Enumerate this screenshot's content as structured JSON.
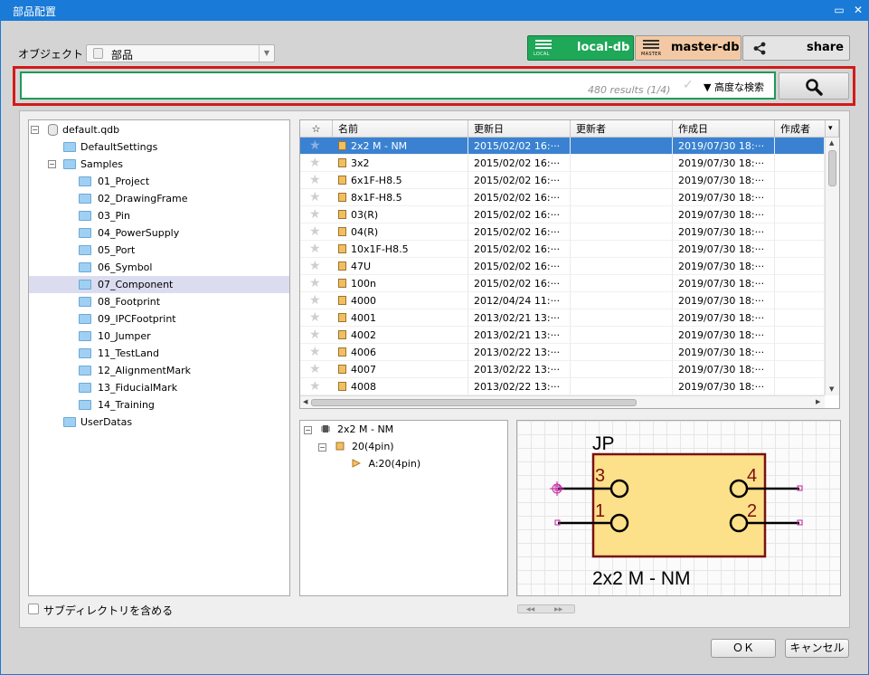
{
  "window": {
    "title": "部品配置",
    "minimize_glyph": "▭",
    "close_glyph": "✕"
  },
  "object": {
    "label": "オブジェクト",
    "value": "部品"
  },
  "db_buttons": [
    {
      "label": "local-db",
      "sub": "LOCAL",
      "color": "#1ea858"
    },
    {
      "label": "master-db",
      "sub": "MASTER",
      "color": "#f2c9a4"
    },
    {
      "label": "share"
    }
  ],
  "search": {
    "value": "",
    "results": "480 results (1/4)",
    "check": "✓",
    "advanced": "▼ 高度な検索"
  },
  "tree": [
    {
      "label": "default.qdb",
      "level": 0,
      "type": "db",
      "toggle": "−"
    },
    {
      "label": "DefaultSettings",
      "level": 1,
      "type": "folder"
    },
    {
      "label": "Samples",
      "level": 1,
      "type": "folder",
      "toggle": "−"
    },
    {
      "label": "01_Project",
      "level": 2,
      "type": "folder"
    },
    {
      "label": "02_DrawingFrame",
      "level": 2,
      "type": "folder"
    },
    {
      "label": "03_Pin",
      "level": 2,
      "type": "folder"
    },
    {
      "label": "04_PowerSupply",
      "level": 2,
      "type": "folder"
    },
    {
      "label": "05_Port",
      "level": 2,
      "type": "folder"
    },
    {
      "label": "06_Symbol",
      "level": 2,
      "type": "folder"
    },
    {
      "label": "07_Component",
      "level": 2,
      "type": "folder",
      "selected": true
    },
    {
      "label": "08_Footprint",
      "level": 2,
      "type": "folder"
    },
    {
      "label": "09_IPCFootprint",
      "level": 2,
      "type": "folder"
    },
    {
      "label": "10_Jumper",
      "level": 2,
      "type": "folder"
    },
    {
      "label": "11_TestLand",
      "level": 2,
      "type": "folder"
    },
    {
      "label": "12_AlignmentMark",
      "level": 2,
      "type": "folder"
    },
    {
      "label": "13_FiducialMark",
      "level": 2,
      "type": "folder"
    },
    {
      "label": "14_Training",
      "level": 2,
      "type": "folder"
    },
    {
      "label": "UserDatas",
      "level": 1,
      "type": "folder"
    }
  ],
  "grid": {
    "columns": [
      "☆",
      "名前",
      "更新日",
      "更新者",
      "作成日",
      "作成者"
    ],
    "menu_glyph": "▾",
    "rows": [
      {
        "star": "★",
        "name": "2x2 M - NM",
        "updated": "2015/02/02 16:···",
        "updater": "",
        "created": "2019/07/30 18:···",
        "creator": "",
        "selected": true
      },
      {
        "star": "★",
        "name": "3x2",
        "updated": "2015/02/02 16:···",
        "updater": "",
        "created": "2019/07/30 18:···",
        "creator": ""
      },
      {
        "star": "★",
        "name": "6x1F-H8.5",
        "updated": "2015/02/02 16:···",
        "updater": "",
        "created": "2019/07/30 18:···",
        "creator": ""
      },
      {
        "star": "★",
        "name": "8x1F-H8.5",
        "updated": "2015/02/02 16:···",
        "updater": "",
        "created": "2019/07/30 18:···",
        "creator": ""
      },
      {
        "star": "★",
        "name": "03(R)",
        "updated": "2015/02/02 16:···",
        "updater": "",
        "created": "2019/07/30 18:···",
        "creator": ""
      },
      {
        "star": "★",
        "name": "04(R)",
        "updated": "2015/02/02 16:···",
        "updater": "",
        "created": "2019/07/30 18:···",
        "creator": ""
      },
      {
        "star": "★",
        "name": "10x1F-H8.5",
        "updated": "2015/02/02 16:···",
        "updater": "",
        "created": "2019/07/30 18:···",
        "creator": ""
      },
      {
        "star": "★",
        "name": "47U",
        "updated": "2015/02/02 16:···",
        "updater": "",
        "created": "2019/07/30 18:···",
        "creator": ""
      },
      {
        "star": "★",
        "name": "100n",
        "updated": "2015/02/02 16:···",
        "updater": "",
        "created": "2019/07/30 18:···",
        "creator": ""
      },
      {
        "star": "★",
        "name": "4000",
        "updated": "2012/04/24 11:···",
        "updater": "",
        "created": "2019/07/30 18:···",
        "creator": ""
      },
      {
        "star": "★",
        "name": "4001",
        "updated": "2013/02/21 13:···",
        "updater": "",
        "created": "2019/07/30 18:···",
        "creator": ""
      },
      {
        "star": "★",
        "name": "4002",
        "updated": "2013/02/21 13:···",
        "updater": "",
        "created": "2019/07/30 18:···",
        "creator": ""
      },
      {
        "star": "★",
        "name": "4006",
        "updated": "2013/02/22 13:···",
        "updater": "",
        "created": "2019/07/30 18:···",
        "creator": ""
      },
      {
        "star": "★",
        "name": "4007",
        "updated": "2013/02/22 13:···",
        "updater": "",
        "created": "2019/07/30 18:···",
        "creator": ""
      },
      {
        "star": "★",
        "name": "4008",
        "updated": "2013/02/22 13:···",
        "updater": "",
        "created": "2019/07/30 18:···",
        "creator": ""
      }
    ],
    "scroll": {
      "up": "▲",
      "down": "▼",
      "left": "◀",
      "right": "▶"
    }
  },
  "component_tree": [
    {
      "label": "2x2 M - NM",
      "toggle": "−",
      "icon": "chip-icon"
    },
    {
      "label": "20(4pin)",
      "toggle": "−",
      "icon": "package-icon"
    },
    {
      "label": "A:20(4pin)",
      "icon": "pin-arrow-icon"
    }
  ],
  "preview": {
    "ref": "JP",
    "name": "2x2 M - NM",
    "pins": [
      "3",
      "1",
      "4",
      "2"
    ],
    "body_color": "#fde08a",
    "outline_color": "#7a1010",
    "nav_left": "◀◀",
    "nav_right": "▶▶"
  },
  "subdir": {
    "label": "サブディレクトリを含める",
    "checked": false
  },
  "buttons": {
    "ok": "ＯＫ",
    "cancel": "キャンセル"
  }
}
